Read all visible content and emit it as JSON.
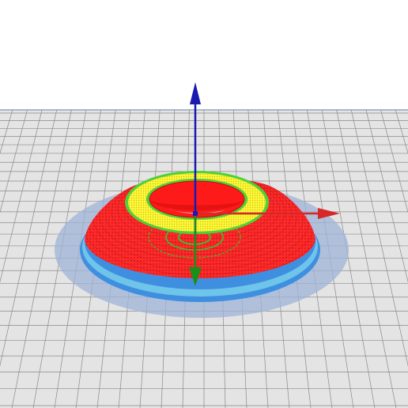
{
  "scene": {
    "type": "3d-slicer-preview",
    "model": "flat-cone-ring",
    "axes": [
      {
        "id": "x",
        "color": "#d62828",
        "direction": "right"
      },
      {
        "id": "y",
        "color": "#1a8f1a",
        "direction": "toward-viewer"
      },
      {
        "id": "z",
        "color": "#1a1ab0",
        "direction": "up"
      }
    ],
    "colors": {
      "background": "#ffffff",
      "bed": "#e4e4e4",
      "grid_line": "#8a8a8a",
      "bed_edge": "#a9b8cc",
      "shadow": "#9fb4d8",
      "brim": "#3f8fe0",
      "wall_outer": "#6fc4ea",
      "shell": "#ff1a1a",
      "top_ring": "#ffff3a",
      "perimeter": "#4fd13a",
      "infill_green": "#2ec82e"
    }
  }
}
